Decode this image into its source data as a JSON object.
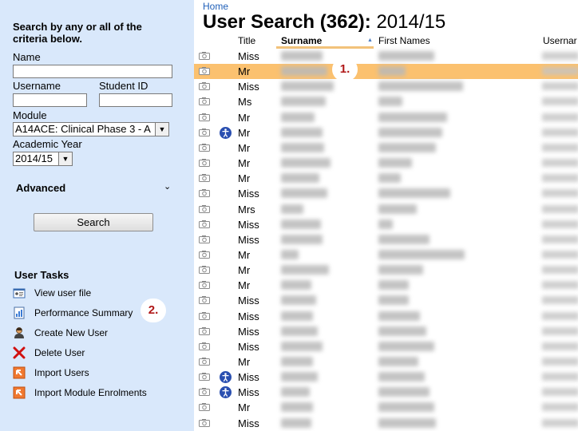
{
  "sidebar": {
    "intro": "Search by any or all of the criteria below.",
    "name_label": "Name",
    "name_value": "",
    "username_label": "Username",
    "username_value": "",
    "studentid_label": "Student ID",
    "studentid_value": "",
    "module_label": "Module",
    "module_value": "A14ACE: Clinical Phase 3 - A",
    "year_label": "Academic Year",
    "year_value": "2014/15",
    "advanced_label": "Advanced",
    "search_button": "Search",
    "tasks_title": "User Tasks",
    "tasks": [
      {
        "label": "View user file",
        "icon": "user-file-icon"
      },
      {
        "label": "Performance Summary",
        "icon": "chart-icon"
      },
      {
        "label": "Create New User",
        "icon": "new-user-icon"
      },
      {
        "label": "Delete User",
        "icon": "delete-x-icon"
      },
      {
        "label": "Import Users",
        "icon": "import-icon"
      },
      {
        "label": "Import Module Enrolments",
        "icon": "import-icon"
      }
    ]
  },
  "annotations": {
    "one": "1.",
    "two": "2."
  },
  "breadcrumb": "Home",
  "title": {
    "prefix": "User Search (362):",
    "year": "2014/15"
  },
  "columns": [
    "Title",
    "Surname",
    "First Names",
    "Usernar"
  ],
  "rows": [
    {
      "title": "Miss",
      "accessibility": false,
      "selected": false
    },
    {
      "title": "Mr",
      "accessibility": false,
      "selected": true
    },
    {
      "title": "Miss",
      "accessibility": false,
      "selected": false
    },
    {
      "title": "Ms",
      "accessibility": false,
      "selected": false
    },
    {
      "title": "Mr",
      "accessibility": false,
      "selected": false
    },
    {
      "title": "Mr",
      "accessibility": true,
      "selected": false
    },
    {
      "title": "Mr",
      "accessibility": false,
      "selected": false
    },
    {
      "title": "Mr",
      "accessibility": false,
      "selected": false
    },
    {
      "title": "Mr",
      "accessibility": false,
      "selected": false
    },
    {
      "title": "Miss",
      "accessibility": false,
      "selected": false
    },
    {
      "title": "Mrs",
      "accessibility": false,
      "selected": false
    },
    {
      "title": "Miss",
      "accessibility": false,
      "selected": false
    },
    {
      "title": "Miss",
      "accessibility": false,
      "selected": false
    },
    {
      "title": "Mr",
      "accessibility": false,
      "selected": false
    },
    {
      "title": "Mr",
      "accessibility": false,
      "selected": false
    },
    {
      "title": "Mr",
      "accessibility": false,
      "selected": false
    },
    {
      "title": "Miss",
      "accessibility": false,
      "selected": false
    },
    {
      "title": "Miss",
      "accessibility": false,
      "selected": false
    },
    {
      "title": "Miss",
      "accessibility": false,
      "selected": false
    },
    {
      "title": "Miss",
      "accessibility": false,
      "selected": false
    },
    {
      "title": "Mr",
      "accessibility": false,
      "selected": false
    },
    {
      "title": "Miss",
      "accessibility": true,
      "selected": false
    },
    {
      "title": "Miss",
      "accessibility": true,
      "selected": false
    },
    {
      "title": "Mr",
      "accessibility": false,
      "selected": false
    },
    {
      "title": "Miss",
      "accessibility": false,
      "selected": false
    }
  ],
  "colors": {
    "sidebar": "#d9e8fb",
    "selected_row": "#fbc16f",
    "link": "#1f5fb8",
    "badge_text": "#b01818"
  }
}
